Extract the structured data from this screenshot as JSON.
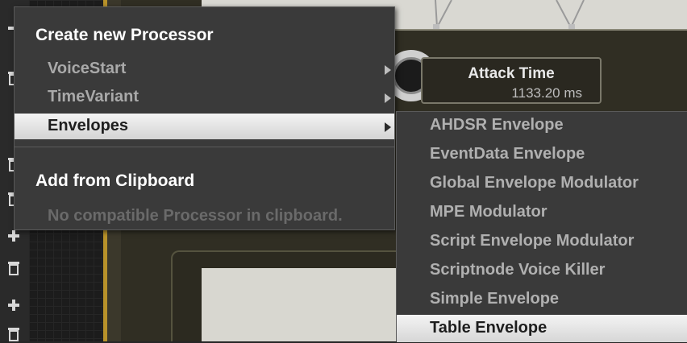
{
  "slider": {
    "label": "Attack Time",
    "value": "1133.20 ms"
  },
  "menu": {
    "header": "Create new Processor",
    "items": [
      {
        "label": "VoiceStart",
        "has_submenu": true,
        "active": false
      },
      {
        "label": "TimeVariant",
        "has_submenu": true,
        "active": false
      },
      {
        "label": "Envelopes",
        "has_submenu": true,
        "active": true
      }
    ],
    "clipboard_header": "Add from Clipboard",
    "clipboard_empty": "No compatible Processor in clipboard."
  },
  "submenu": {
    "items": [
      {
        "label": "AHDSR Envelope",
        "active": false
      },
      {
        "label": "EventData Envelope",
        "active": false
      },
      {
        "label": "Global Envelope Modulator",
        "active": false
      },
      {
        "label": "MPE Modulator",
        "active": false
      },
      {
        "label": "Script Envelope Modulator",
        "active": false
      },
      {
        "label": "Scriptnode Voice Killer",
        "active": false
      },
      {
        "label": "Simple Envelope",
        "active": false
      },
      {
        "label": "Table Envelope",
        "active": true
      }
    ]
  },
  "icons": {
    "left_strip": [
      "minus-icon",
      "trash-icon",
      "trash-icon",
      "trash-icon",
      "plus-icon",
      "trash-icon",
      "plus-icon",
      "trash-icon"
    ]
  },
  "colors": {
    "accent_gold": "#b8922a",
    "menu_bg": "#3a3a3a",
    "highlight": "#e6e6e6"
  }
}
